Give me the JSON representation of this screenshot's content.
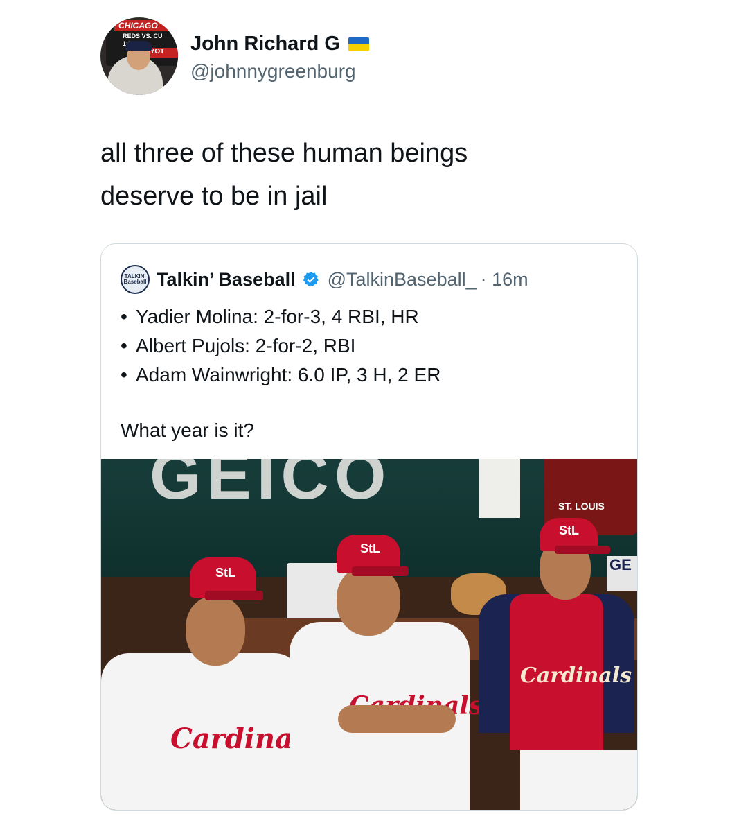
{
  "tweet": {
    "author_name": "John Richard G",
    "author_handle": "@johnnygreenburg",
    "avatar_sign": {
      "line1": "CHICAGO",
      "line2": "REDS VS. CU",
      "line3": "1:20 P.M.",
      "line4": "TOYOT"
    },
    "text_line1": "all three of these human beings",
    "text_line2": "deserve to be in jail"
  },
  "quoted": {
    "logo_text": "TALKIN' Baseball",
    "author_name": "Talkin’ Baseball",
    "author_handle": "@TalkinBaseball_",
    "time": "· 16m",
    "bullets": [
      "Yadier Molina: 2-for-3, 4 RBI, HR",
      "Albert Pujols: 2-for-2, RBI",
      "Adam Wainwright: 6.0 IP, 3 H, 2 ER"
    ],
    "bullet_symbol": "•",
    "question": "What year is it?",
    "photo": {
      "wall_ad": "GEICO",
      "sign": "ST. LOUIS",
      "right_ad": "GE",
      "cap_logo": "StL",
      "jersey_script": "Cardinals"
    }
  },
  "colors": {
    "cardinals_red": "#c8102e",
    "text_primary": "#0f1419",
    "text_secondary": "#536471",
    "verified_blue": "#1d9bf0"
  }
}
